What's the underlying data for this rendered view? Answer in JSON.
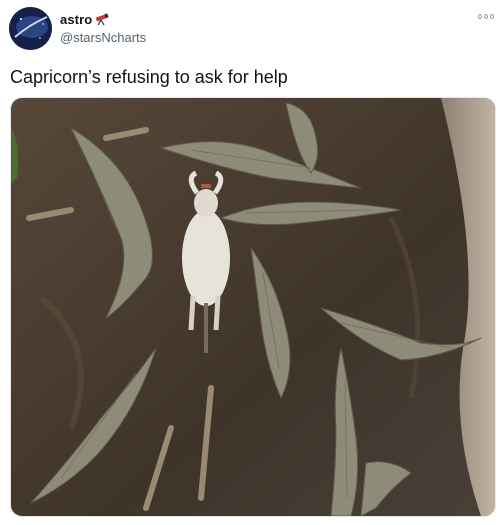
{
  "tweet": {
    "author": {
      "display_name": "astro",
      "name_emoji_icon": "telescope-icon",
      "handle": "@starsNcharts",
      "avatar_icon": "galaxy-avatar"
    },
    "more_icon": "ellipsis-icon",
    "text": "Capricorn’s refusing to ask for help",
    "media": {
      "description_icon": "goat-crocodiles-photo",
      "colors": {
        "mud": "#4a3d30",
        "water": "#b7a999",
        "croc": "#8d8a79",
        "goat": "#e6e2da"
      }
    }
  }
}
